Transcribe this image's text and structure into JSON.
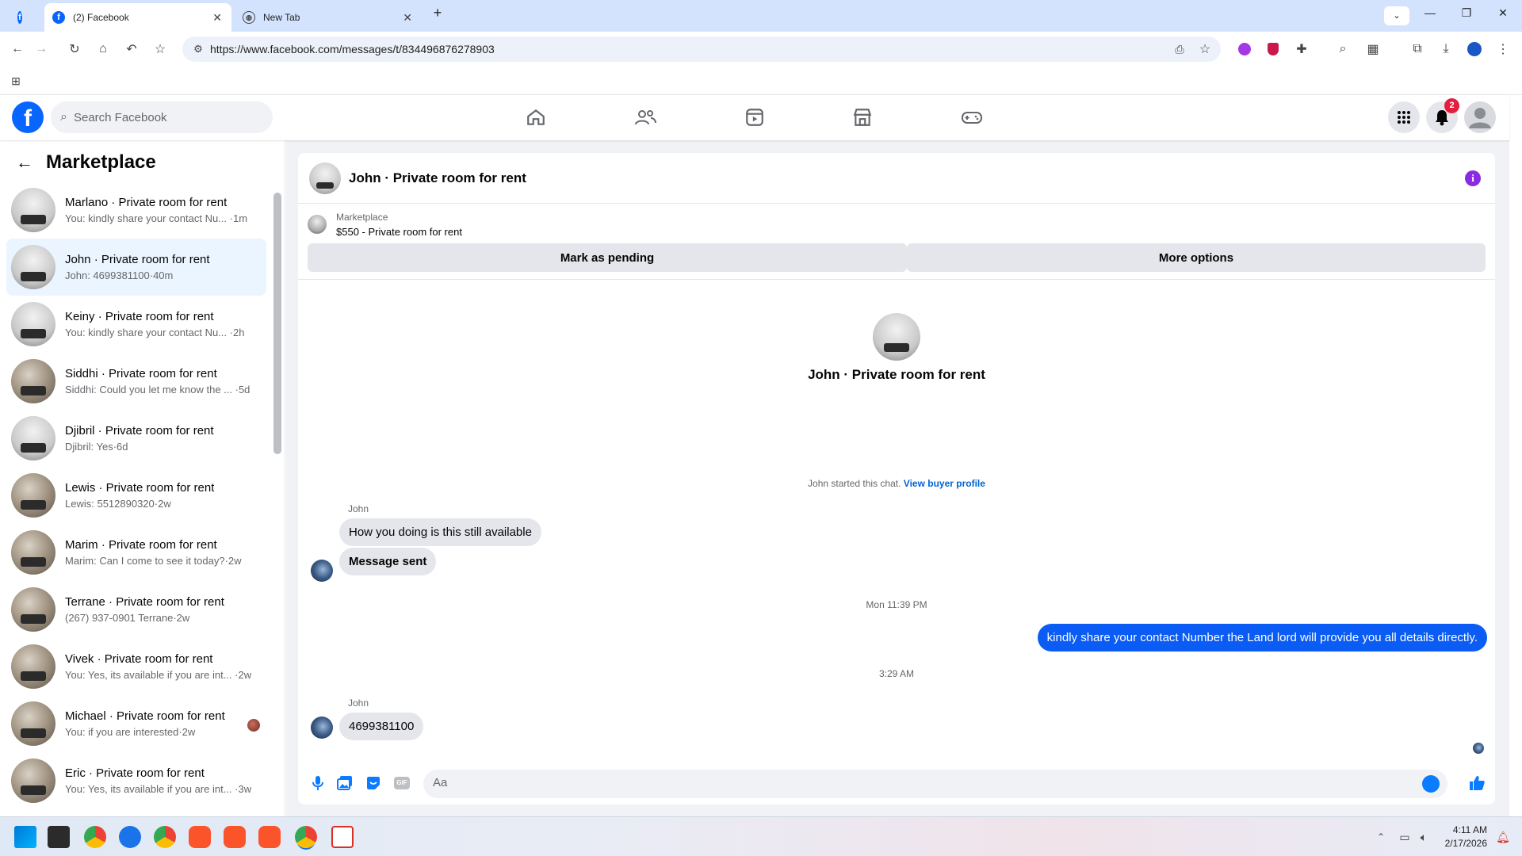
{
  "browser": {
    "tabs": [
      {
        "title": "(2) Facebook",
        "active": true
      },
      {
        "title": "New Tab",
        "active": false
      }
    ],
    "url": "https://www.facebook.com/messages/t/834496876278903"
  },
  "fb": {
    "search_placeholder": "Search Facebook",
    "notification_count": "2",
    "brand_color": "#0866ff"
  },
  "left": {
    "title": "Marketplace",
    "conversations": [
      {
        "name": "Marlano · Private room for rent",
        "preview": "You: kindly share your contact Nu... ·1m"
      },
      {
        "name": "John · Private room for rent",
        "preview": "John: 4699381100·40m"
      },
      {
        "name": "Keiny · Private room for rent",
        "preview": "You: kindly share your contact Nu... ·2h"
      },
      {
        "name": "Siddhi · Private room for rent",
        "preview": "Siddhi: Could you let me know the ... ·5d"
      },
      {
        "name": "Djibril · Private room for rent",
        "preview": "Djibril: Yes·6d"
      },
      {
        "name": "Lewis · Private room for rent",
        "preview": "Lewis: 5512890320·2w"
      },
      {
        "name": "Marim · Private room for rent",
        "preview": "Marim: Can I come to see it today?·2w"
      },
      {
        "name": "Terrane · Private room for rent",
        "preview": "(267) 937-0901 Terrane·2w"
      },
      {
        "name": "Vivek · Private room for rent",
        "preview": "You: Yes, its available if you are int... ·2w"
      },
      {
        "name": "Michael · Private room for rent",
        "preview": "You: if you are interested·2w"
      },
      {
        "name": "Eric · Private room for rent",
        "preview": "You: Yes, its available if you are int... ·3w"
      }
    ]
  },
  "chat": {
    "title": "John · Private room for rent",
    "marketplace_label": "Marketplace",
    "listing": "$550 - Private room for rent",
    "btn_pending": "Mark as pending",
    "btn_more": "More options",
    "intro_name": "John · Private room for rent",
    "started_text": "John started this chat.",
    "view_profile": "View buyer profile",
    "sender1": "John",
    "msg1": "How you doing is this still available",
    "msg2": "Message sent",
    "time1": "Mon 11:39 PM",
    "msg_out": "kindly share your contact Number the Land lord will provide you all details directly.",
    "time2": "3:29 AM",
    "sender2": "John",
    "msg3": "4699381100",
    "input_placeholder": "Aa",
    "outgoing_color": "#0a5cf5"
  },
  "taskbar": {
    "time": "4:11 AM",
    "date": "2/17/2026"
  }
}
